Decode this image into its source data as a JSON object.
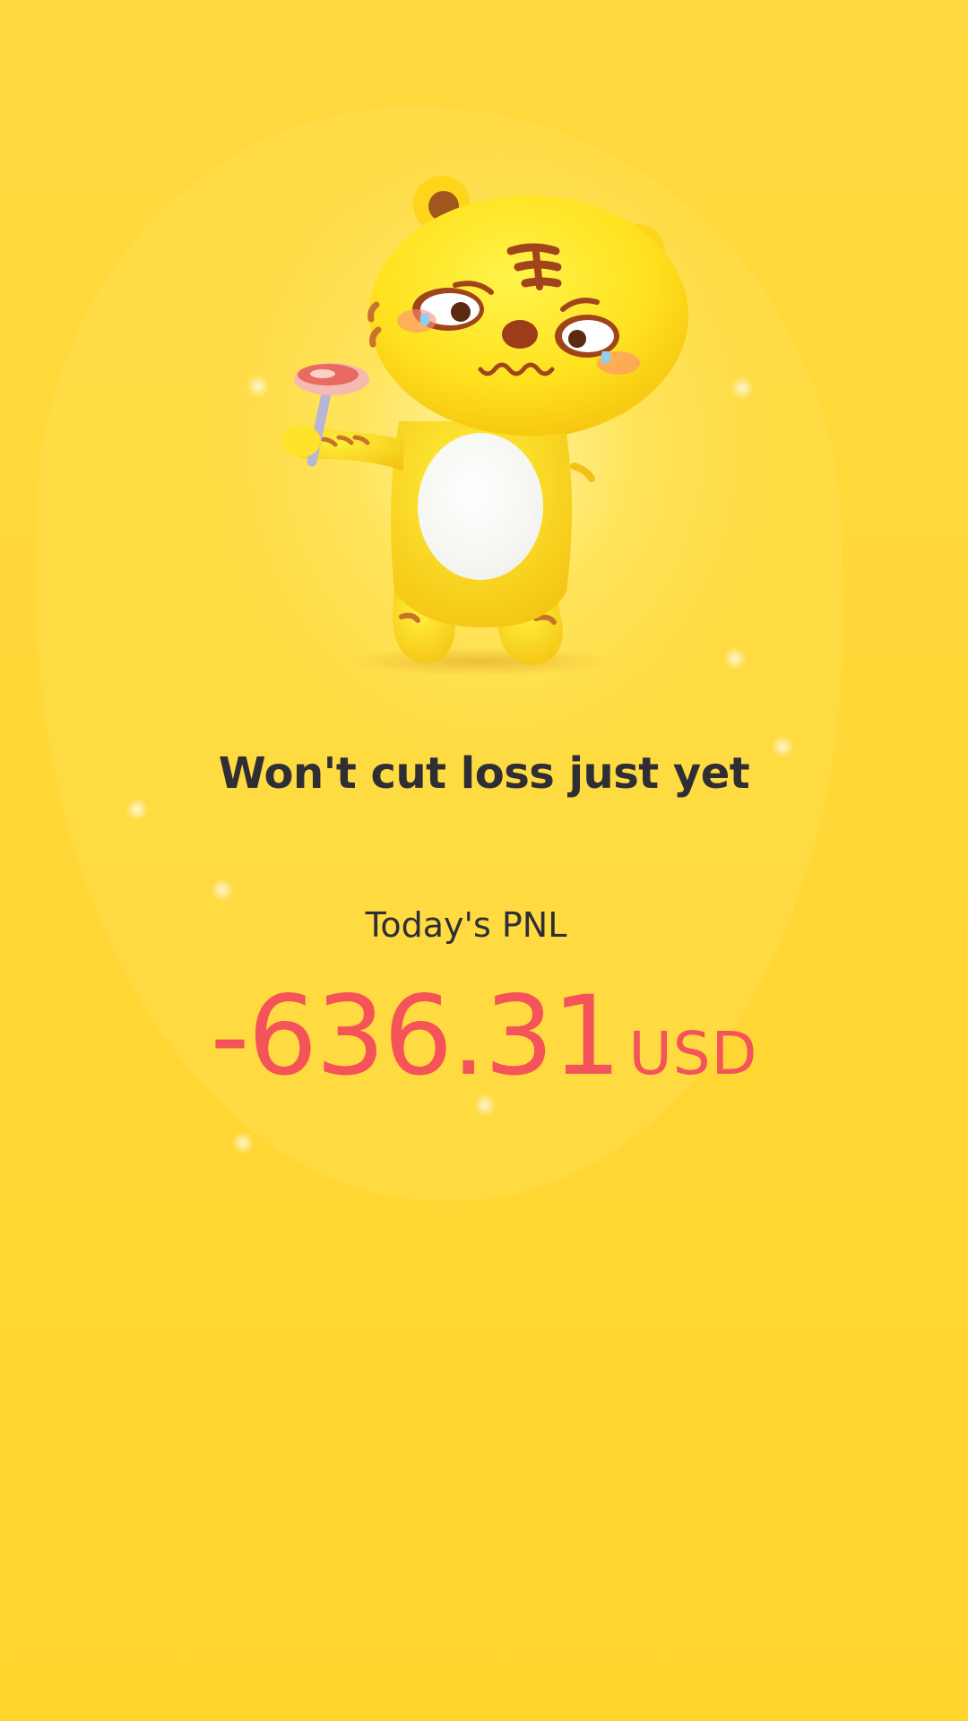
{
  "theme": {
    "background": "#ffd83a",
    "text_color": "#2e2e34",
    "loss_color": "#f4535a"
  },
  "mascot": {
    "icon": "crying-tiger-mascot-with-steak-icon"
  },
  "headline": "Won't cut loss just yet",
  "pnl": {
    "label": "Today's PNL",
    "value": "-636.31",
    "unit": "USD"
  }
}
